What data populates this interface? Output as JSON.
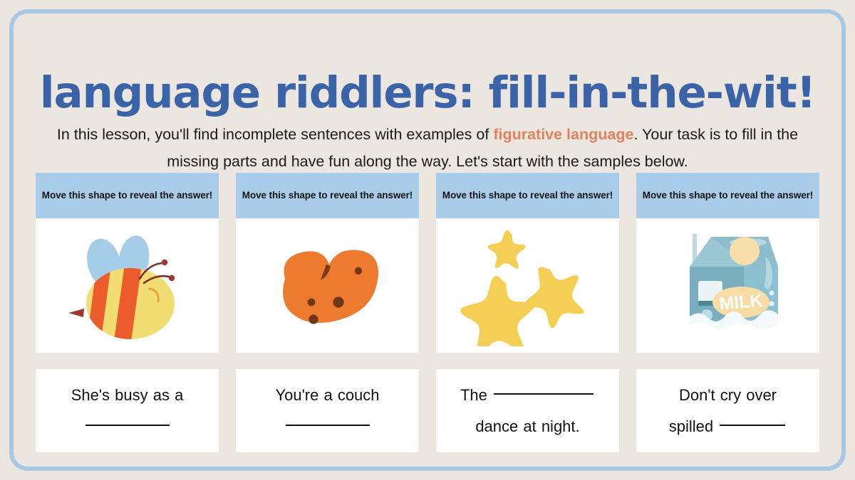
{
  "slide": {
    "title": "language riddlers: fill-in-the-wit!",
    "intro": {
      "before": "In this lesson, you'll find incomplete sentences with examples of ",
      "highlight": "figurative language",
      "after": ". Your task is to fill in the missing parts and have fun along the way. Let's start with the samples below."
    },
    "colors": {
      "background": "#ece6e1",
      "frame_border": "#a7c9e4",
      "title_blue": "#3b63a7",
      "accent_orange": "#e2825a",
      "card_header_blue": "#a9cde8",
      "card_white": "#ffffff",
      "text_dark": "#111111"
    }
  },
  "cards": [
    {
      "header": "Move this shape to reveal the answer!",
      "illustration": "bee-illustration",
      "sentence_line1": "She's busy as a",
      "sentence_line2": "",
      "blank_after_line1": false,
      "blank_line2": true
    },
    {
      "header": "Move this shape to reveal the answer!",
      "illustration": "potato-illustration",
      "sentence_line1": "You're a couch",
      "sentence_line2": "",
      "blank_after_line1": false,
      "blank_line2": true
    },
    {
      "header": "Move this shape to reveal the answer!",
      "illustration": "stars-illustration",
      "sentence_line1": "The",
      "sentence_line2": "dance at night.",
      "blank_after_line1": true,
      "blank_line2": false
    },
    {
      "header": "Move this shape to reveal the answer!",
      "illustration": "milk-carton-illustration",
      "sentence_line1": "Don't cry over",
      "sentence_line2": "spilled",
      "blank_after_line1": false,
      "blank_line2": false
    }
  ]
}
